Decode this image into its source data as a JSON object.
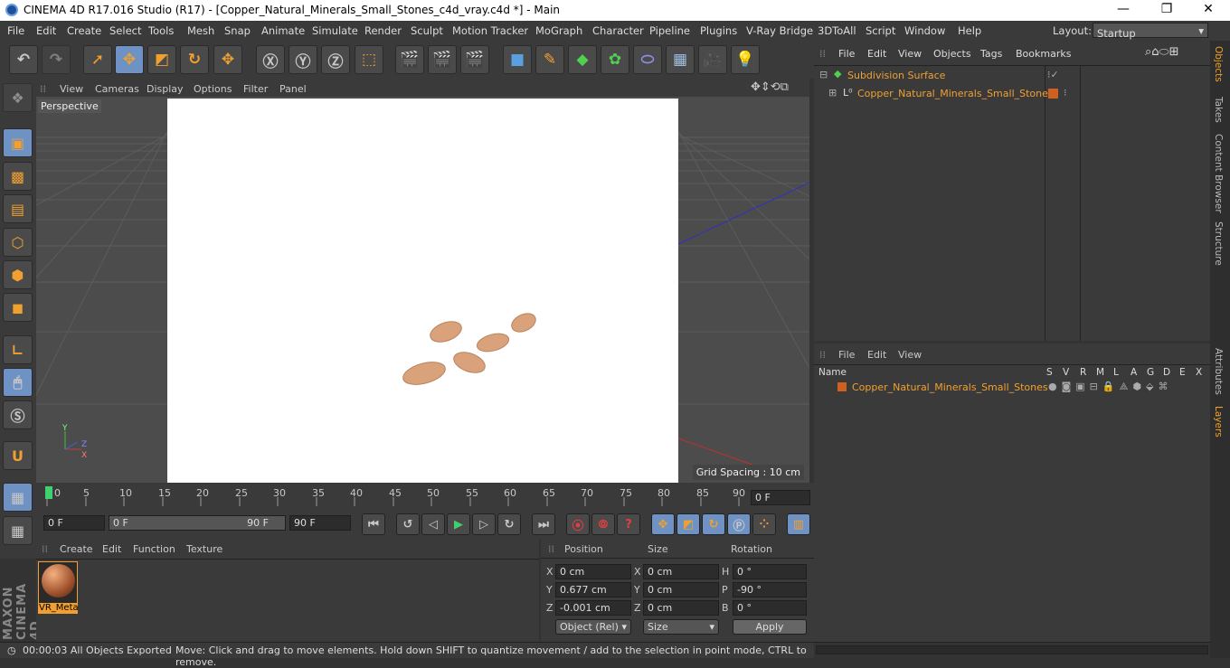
{
  "window": {
    "title": "CINEMA 4D R17.016 Studio (R17) - [Copper_Natural_Minerals_Small_Stones_c4d_vray.c4d *] - Main",
    "minimize": "—",
    "restore": "❐",
    "close": "✕"
  },
  "menu": [
    "File",
    "Edit",
    "Create",
    "Select",
    "Tools",
    "Mesh",
    "Snap",
    "Animate",
    "Simulate",
    "Render",
    "Sculpt",
    "Motion Tracker",
    "MoGraph",
    "Character",
    "Pipeline",
    "Plugins",
    "V-Ray Bridge",
    "3DToAll",
    "Script",
    "Window",
    "Help"
  ],
  "layout": {
    "label": "Layout:",
    "value": "Startup"
  },
  "viewport": {
    "menu": [
      "View",
      "Cameras",
      "Display",
      "Options",
      "Filter",
      "Panel"
    ],
    "camera_label": "Perspective",
    "grid_spacing": "Grid Spacing : 10 cm",
    "axis": {
      "x": "X",
      "y": "Y",
      "z": "Z"
    }
  },
  "timeline": {
    "ticks": [
      "0",
      "5",
      "10",
      "15",
      "20",
      "25",
      "30",
      "35",
      "40",
      "45",
      "50",
      "55",
      "60",
      "65",
      "70",
      "75",
      "80",
      "85",
      "90"
    ],
    "current_frame": "0 F",
    "start_field": "0 F",
    "range_start": "0 F",
    "range_end": "90 F",
    "end_field": "90 F"
  },
  "material_panel": {
    "menu": [
      "Create",
      "Edit",
      "Function",
      "Texture"
    ],
    "materials": [
      {
        "name": "VR_Meta"
      }
    ]
  },
  "coords": {
    "headers": {
      "position": "Position",
      "size": "Size",
      "rotation": "Rotation"
    },
    "rows": [
      {
        "axis": "X",
        "pos": "0 cm",
        "size_axis": "X",
        "size": "0 cm",
        "rot_axis": "H",
        "rot": "0 °"
      },
      {
        "axis": "Y",
        "pos": "0.677 cm",
        "size_axis": "Y",
        "size": "0 cm",
        "rot_axis": "P",
        "rot": "-90 °"
      },
      {
        "axis": "Z",
        "pos": "-0.001 cm",
        "size_axis": "Z",
        "size": "0 cm",
        "rot_axis": "B",
        "rot": "0 °"
      }
    ],
    "mode": "Object (Rel)",
    "size_mode": "Size",
    "apply": "Apply"
  },
  "status": {
    "time": "00:00:03 All Objects Exported",
    "hint": "Move: Click and drag to move elements. Hold down SHIFT to quantize movement / add to the selection in point mode, CTRL to remove."
  },
  "objects_panel": {
    "menu": [
      "File",
      "Edit",
      "View",
      "Objects",
      "Tags",
      "Bookmarks"
    ],
    "items": [
      {
        "name": "Subdivision Surface"
      },
      {
        "name": "Copper_Natural_Minerals_Small_Stones"
      }
    ]
  },
  "layers_panel": {
    "menu": [
      "File",
      "Edit",
      "View"
    ],
    "columns": [
      "Name",
      "S",
      "V",
      "R",
      "M",
      "L",
      "A",
      "G",
      "D",
      "E",
      "X"
    ],
    "items": [
      {
        "name": "Copper_Natural_Minerals_Small_Stones"
      }
    ]
  },
  "side_tabs": [
    "Objects",
    "Takes",
    "Content Browser",
    "Structure",
    "Attributes",
    "Layers"
  ],
  "maxon_brand": "MAXON CINEMA 4D",
  "colors": {
    "accent": "#f0a030",
    "selected_tool": "#6f92c4",
    "layer_color": "#d06020"
  }
}
